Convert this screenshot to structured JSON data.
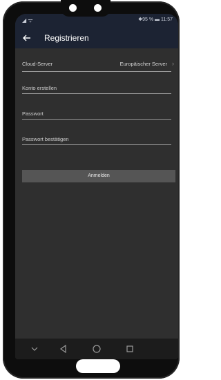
{
  "status": {
    "left": "◢ ᯤ",
    "right": "✱95 % ▬ 11:57"
  },
  "appbar": {
    "title": "Registrieren"
  },
  "cloud_server": {
    "label": "Cloud-Server",
    "value": "Europäischer Server"
  },
  "fields": {
    "account_placeholder": "Konto erstellen",
    "password_placeholder": "Passwort",
    "confirm_placeholder": "Passwort bestätigen"
  },
  "buttons": {
    "login": "Anmelden"
  },
  "icons": {
    "back": "arrow-left",
    "cloud_chevron": "chevron-right",
    "nav_down": "chevron-down",
    "nav_back": "triangle-back",
    "nav_home": "circle-home",
    "nav_recent": "square-recent"
  },
  "colors": {
    "appbar": "#1c2333",
    "background": "#2f2f2f",
    "button": "#555555"
  }
}
